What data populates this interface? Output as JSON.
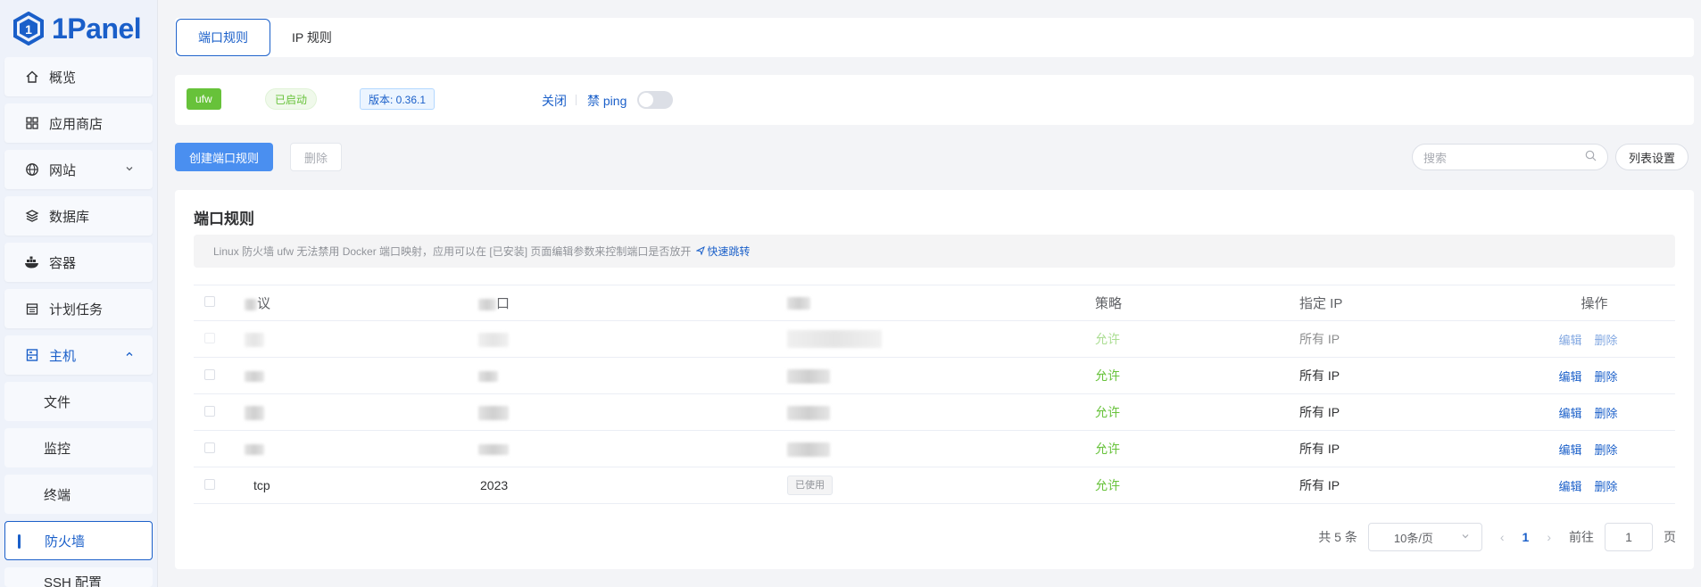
{
  "app": {
    "logo_text": "1Panel"
  },
  "sidebar": {
    "items": [
      {
        "label": "概览",
        "icon": "home-icon"
      },
      {
        "label": "应用商店",
        "icon": "grid-icon"
      },
      {
        "label": "网站",
        "icon": "globe-icon"
      },
      {
        "label": "数据库",
        "icon": "layers-icon"
      },
      {
        "label": "容器",
        "icon": "docker-icon"
      },
      {
        "label": "计划任务",
        "icon": "calendar-icon"
      },
      {
        "label": "主机",
        "icon": "host-icon"
      }
    ],
    "sub_items": [
      "文件",
      "监控",
      "终端",
      "防火墙",
      "SSH 配置"
    ]
  },
  "tabs": [
    {
      "label": "端口规则"
    },
    {
      "label": "IP 规则"
    }
  ],
  "status": {
    "engine": "ufw",
    "state": "已启动",
    "version": "版本: 0.36.1",
    "close_label": "关闭",
    "ping_label": "禁 ping",
    "ping_enabled": false
  },
  "toolbar": {
    "create_label": "创建端口规则",
    "delete_label": "删除",
    "search_placeholder": "搜索",
    "columns_label": "列表设置"
  },
  "card": {
    "title": "端口规则",
    "alert_text": "Linux 防火墙 ufw 无法禁用 Docker 端口映射，应用可以在 [已安装] 页面编辑参数来控制端口是否放开",
    "alert_link": "快速跳转"
  },
  "table": {
    "headers": [
      "议",
      "口",
      "",
      "策略",
      "指定 IP",
      "操作"
    ],
    "rows": [
      {
        "protocol": "",
        "port": "",
        "status": "",
        "strategy": "允许",
        "ip": "所有 IP",
        "edit": "编辑",
        "delete": "删除"
      },
      {
        "protocol": "",
        "port": "",
        "status": "",
        "strategy": "允许",
        "ip": "所有 IP",
        "edit": "编辑",
        "delete": "删除"
      },
      {
        "protocol": "",
        "port": "",
        "status": "",
        "strategy": "允许",
        "ip": "所有 IP",
        "edit": "编辑",
        "delete": "删除"
      },
      {
        "protocol": "",
        "port": "",
        "status": "",
        "strategy": "允许",
        "ip": "所有 IP",
        "edit": "编辑",
        "delete": "删除"
      },
      {
        "protocol": "tcp",
        "port": "2023",
        "status": "已使用",
        "strategy": "允许",
        "ip": "所有 IP",
        "edit": "编辑",
        "delete": "删除"
      }
    ]
  },
  "pagination": {
    "total": "共 5 条",
    "page_size": "10条/页",
    "current": "1",
    "goto_label": "前往",
    "goto_value": "1",
    "page_suffix": "页"
  }
}
